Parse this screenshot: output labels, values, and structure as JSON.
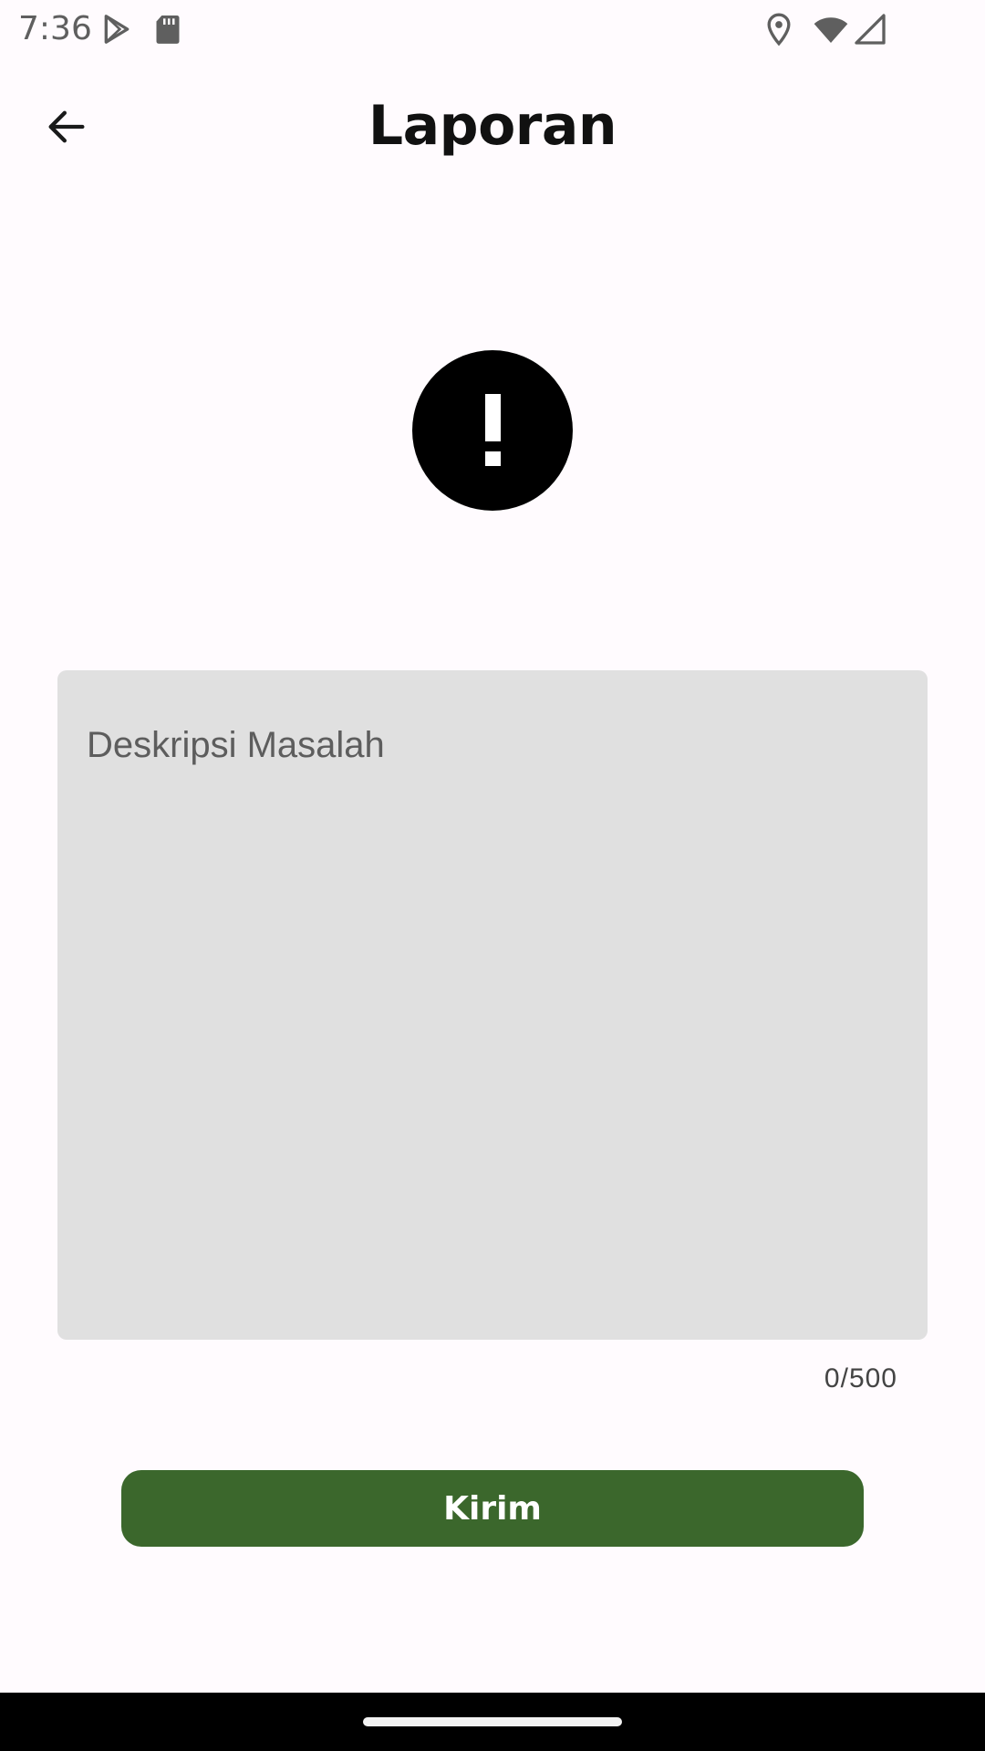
{
  "status_bar": {
    "time": "7:36",
    "icons": [
      "play-store-icon",
      "sd-card-icon",
      "location-icon",
      "wifi-icon",
      "cellular-signal-icon"
    ],
    "color": "#5f5f5f"
  },
  "app_bar": {
    "back_icon": "arrow-back-icon",
    "title": "Laporan"
  },
  "alert": {
    "icon": "exclamation-circle-icon",
    "color": "#000000"
  },
  "form": {
    "description_placeholder": "Deskripsi Masalah",
    "description_value": "",
    "char_counter": "0/500",
    "field_background": "#e0e0e0"
  },
  "actions": {
    "submit_label": "Kirim",
    "submit_color": "#3b672c"
  },
  "navigation": {
    "home_indicator": "home-gesture-bar"
  }
}
